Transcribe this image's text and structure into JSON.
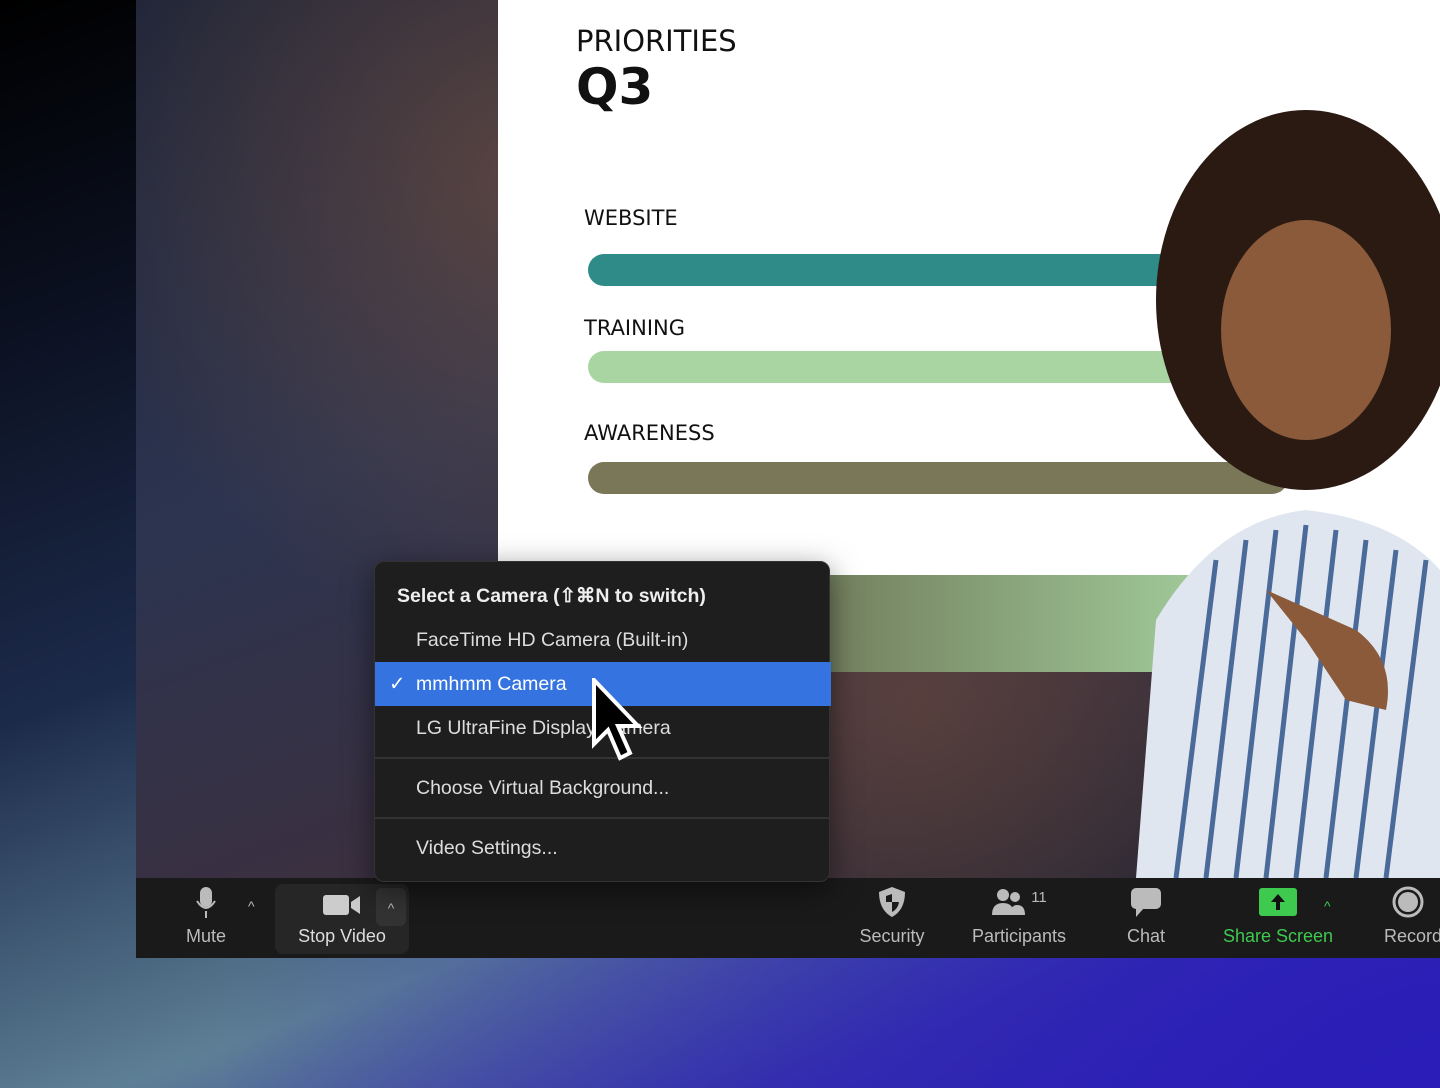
{
  "slide": {
    "title": "PRIORITIES",
    "subtitle": "Q3",
    "bars": [
      {
        "label": "WEBSITE",
        "color": "#2e8b87"
      },
      {
        "label": "TRAINING",
        "color": "#a8d5a2"
      },
      {
        "label": "AWARENESS",
        "color": "#7a7658"
      }
    ]
  },
  "camera_menu": {
    "header": "Select a Camera (⇧⌘N to switch)",
    "items": [
      {
        "label": "FaceTime HD Camera (Built-in)",
        "selected": false
      },
      {
        "label": "mmhmm Camera",
        "selected": true
      },
      {
        "label": "LG UltraFine Display Camera",
        "selected": false
      }
    ],
    "virtual_background": "Choose Virtual Background...",
    "video_settings": "Video Settings...",
    "check": "✓"
  },
  "toolbar": {
    "mute": "Mute",
    "stop_video": "Stop Video",
    "security": "Security",
    "participants": "Participants",
    "participants_count": "11",
    "chat": "Chat",
    "share_screen": "Share Screen",
    "record": "Record",
    "caret": "^"
  },
  "colors": {
    "selected": "#3574e0",
    "share": "#3ec94f"
  }
}
